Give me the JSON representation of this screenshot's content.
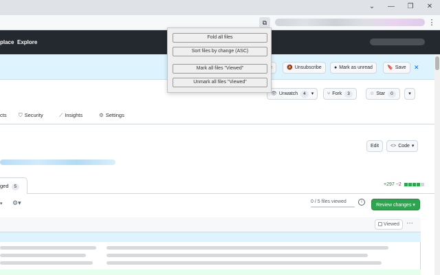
{
  "browser": {
    "window_controls": [
      "⌄",
      "—",
      "❐",
      "✕"
    ],
    "extension_icon": "⧉",
    "menu_icon": "⋮"
  },
  "gh_header": {
    "nav": [
      "place",
      "Explore"
    ]
  },
  "banner": {
    "partial_label": "e",
    "unsubscribe": "Unsubscribe",
    "mark_unread": "Mark as unread",
    "save": "Save",
    "close": "✕"
  },
  "repo_actions": {
    "unwatch": "Unwatch",
    "unwatch_count": "4",
    "fork": "Fork",
    "fork_count": "3",
    "star": "Star",
    "star_count": "0"
  },
  "repo_tabs": [
    {
      "label": "cts",
      "icon": ""
    },
    {
      "label": "Security",
      "icon": "shield-icon"
    },
    {
      "label": "Insights",
      "icon": "graph-icon"
    },
    {
      "label": "Settings",
      "icon": "gear-icon"
    }
  ],
  "pr": {
    "edit": "Edit",
    "code": "Code",
    "tab_label": "ged",
    "tab_count": "5",
    "additions": "+297",
    "deletions": "−2",
    "files_viewed": "0 / 5 files viewed",
    "files_viewed_fraction": 0,
    "review_changes": "Review changes",
    "viewed": "Viewed"
  },
  "popup": {
    "items": [
      "Fold all files",
      "Sort files by change (ASC)",
      "Mark all files \"Viewed\"",
      "Unmark all files \"Viewed\""
    ]
  },
  "colors": {
    "header": "#24292f",
    "banner": "#ddf4ff",
    "review_button": "#2da44e",
    "additions": "#1a7f37",
    "deletions": "#cf222e"
  }
}
